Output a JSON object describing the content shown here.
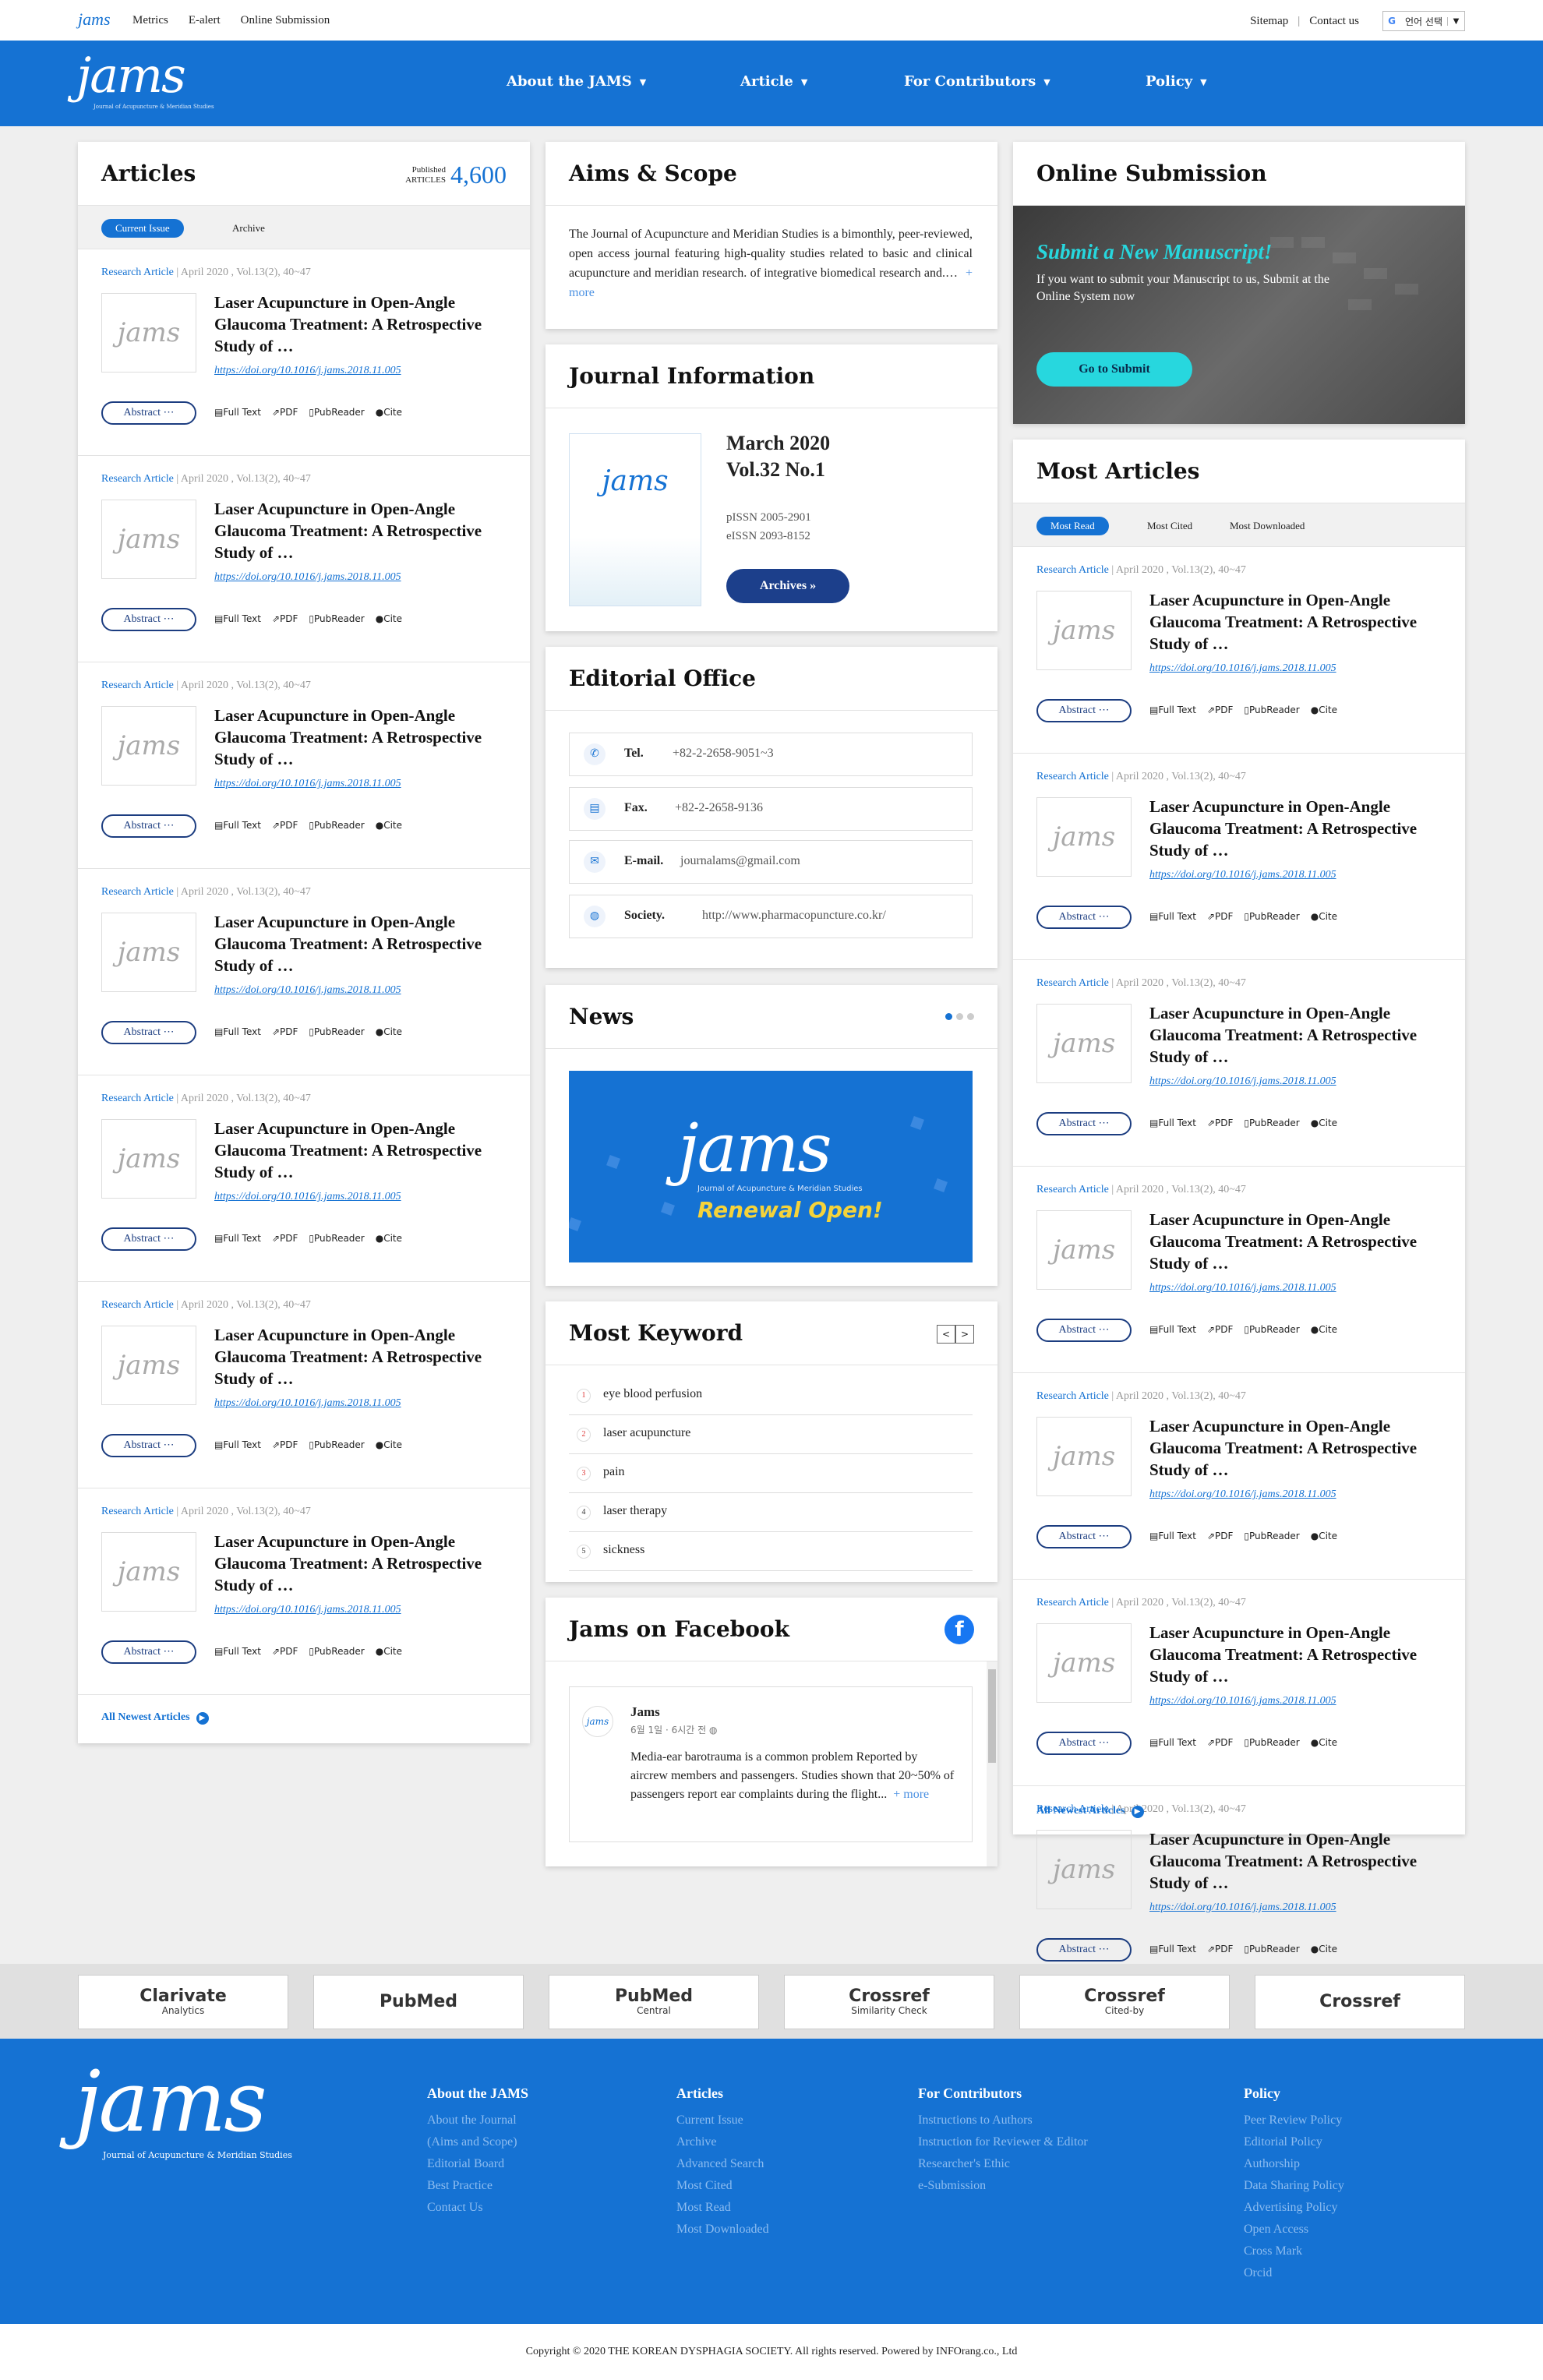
{
  "util": {
    "logo": "jams",
    "links": [
      "Metrics",
      "E-alert",
      "Online Submission"
    ],
    "sitemap": "Sitemap",
    "contact": "Contact us",
    "lang": "언어 선택"
  },
  "nav": {
    "logo": "jams",
    "logo_sub": "Journal of Acupuncture & Meridian Studies",
    "menu": [
      "About the JAMS",
      "Article",
      "For Contributors",
      "Policy"
    ]
  },
  "articles_panel": {
    "title": "Articles",
    "published_label_1": "Published",
    "published_label_2": "ARTICLES",
    "published_count": "4,600",
    "tabs": [
      "Current Issue",
      "Archive"
    ],
    "all_link": "All Newest Articles"
  },
  "article_template": {
    "type": "Research Article",
    "date": "| April 2020 , Vol.13(2), 40~47",
    "title": "Laser Acupuncture in Open-Angle Glaucoma Treatment: A Retrospective Study of …",
    "doi": "https://doi.org/10.1016/j.jams.2018.11.005",
    "thumb": "jams",
    "abstract": "Abstract ⋯",
    "actions": [
      "Full Text",
      "PDF",
      "PubReader",
      "Cite"
    ]
  },
  "aims": {
    "title": "Aims & Scope",
    "text": "The Journal of Acupuncture and Meridian Studies is a bimonthly, peer-reviewed, open access journal featuring high-quality studies related to basic and clinical acupuncture and meridian research. of integrative biomedical research and.…",
    "more": "+ more"
  },
  "journal": {
    "title": "Journal Information",
    "cover": "jams",
    "issue_1": "March 2020",
    "issue_2": "Vol.32 No.1",
    "pissn": "pISSN 2005-2901",
    "eissn": "eISSN 2093-8152",
    "archives": "Archives  »"
  },
  "office": {
    "title": "Editorial Office",
    "rows": [
      {
        "icon": "phone-icon",
        "glyph": "✆",
        "label": "Tel.",
        "value": "+82-2-2658-9051~3"
      },
      {
        "icon": "fax-icon",
        "glyph": "▤",
        "label": "Fax.",
        "value": "+82-2-2658-9136"
      },
      {
        "icon": "mail-icon",
        "glyph": "✉",
        "label": "E-mail.",
        "value": "journalams@gmail.com"
      },
      {
        "icon": "globe-icon",
        "glyph": "◍",
        "label": "Society.",
        "value": "http://www.pharmacopuncture.co.kr/"
      }
    ]
  },
  "news": {
    "title": "News",
    "banner_logo": "jams",
    "banner_sub": "Journal of Acupuncture & Meridian Studies",
    "banner_text": "Renewal Open!"
  },
  "keyword": {
    "title": "Most Keyword",
    "items": [
      "eye blood perfusion",
      "laser acupuncture",
      "pain",
      "laser therapy",
      "sickness"
    ]
  },
  "facebook": {
    "title": "Jams on Facebook",
    "name": "Jams",
    "avatar": "jams",
    "time": "6월 1일 · 6시간 전 ◍",
    "body": "Media-ear barotrauma is a common problem Reported by aircrew members and passengers. Studies shown that 20~50% of passengers report ear complaints during the flight...",
    "more": "+ more"
  },
  "submission": {
    "title": "Online Submission",
    "headline": "Submit a New Manuscript!",
    "desc": "If you want to submit your Manuscript to us, Submit at the Online System now",
    "button": "Go to Submit"
  },
  "most": {
    "title": "Most Articles",
    "tabs": [
      "Most Read",
      "Most Cited",
      "Most Downloaded"
    ],
    "all_link": "All Newest Articles"
  },
  "partners": [
    {
      "name": "Clarivate",
      "sub": "Analytics"
    },
    {
      "name": "PubMed",
      "sub": ""
    },
    {
      "name": "PubMed",
      "sub": "Central"
    },
    {
      "name": "Crossref",
      "sub": "Similarity Check"
    },
    {
      "name": "Crossref",
      "sub": "Cited-by"
    },
    {
      "name": "Crossref",
      "sub": ""
    }
  ],
  "footer": {
    "logo": "jams",
    "logo_sub": "Journal of Acupuncture & Meridian Studies",
    "cols": [
      {
        "title": "About the JAMS",
        "items": [
          "About the Journal",
          "(Aims and Scope)",
          "Editorial Board",
          "Best Practice",
          "Contact Us"
        ]
      },
      {
        "title": "Articles",
        "items": [
          "Current Issue",
          "Archive",
          "Advanced Search",
          "Most Cited",
          "Most Read",
          "Most Downloaded"
        ]
      },
      {
        "title": "For Contributors",
        "items": [
          "Instructions to Authors",
          "Instruction for Reviewer & Editor",
          "Researcher's Ethic",
          "e-Submission"
        ]
      },
      {
        "title": "Policy",
        "items": [
          "Peer Review Policy",
          "Editorial Policy",
          "Authorship",
          "Data Sharing Policy",
          "Advertising Policy",
          "Open Access",
          "Cross Mark",
          "Orcid"
        ]
      }
    ],
    "copyright": "Copyright © 2020  THE KOREAN DYSPHAGIA SOCIETY. All rights reserved. Powered by INFOrang.co., Ltd"
  },
  "colors": {
    "primary": "#1572d3",
    "accent": "#27d7de",
    "dark_button": "#1c3f8b"
  }
}
